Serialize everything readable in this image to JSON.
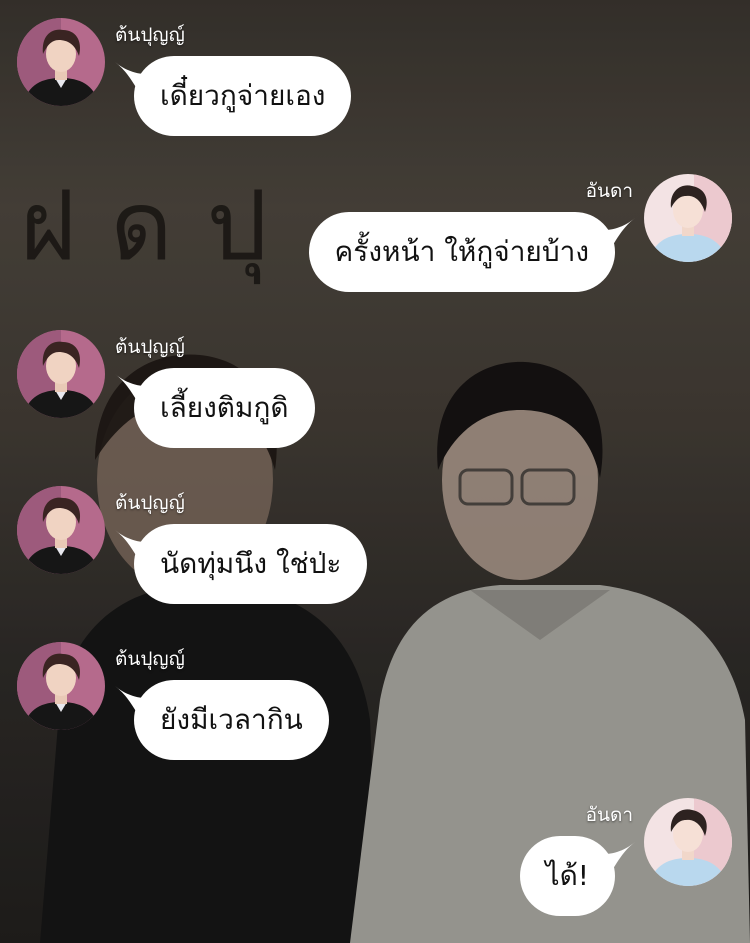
{
  "background": {
    "scrawl_text": "ฝดปุ"
  },
  "messages": [
    {
      "side": "left",
      "sender": "ต้นปุญญ์",
      "text": "เดี๋ยวกูจ่ายเอง",
      "avatar": "boy-dark-avatar"
    },
    {
      "side": "right",
      "sender": "อันดา",
      "text": "ครั้งหน้า ให้กูจ่ายบ้าง",
      "avatar": "boy-light-avatar"
    },
    {
      "side": "left",
      "sender": "ต้นปุญญ์",
      "text": "เลี้ยงติมกูดิ",
      "avatar": "boy-dark-avatar"
    },
    {
      "side": "left",
      "sender": "ต้นปุญญ์",
      "text": "นัดทุ่มนึง ใช่ป่ะ",
      "avatar": "boy-dark-avatar"
    },
    {
      "side": "left",
      "sender": "ต้นปุญญ์",
      "text": "ยังมีเวลากิน",
      "avatar": "boy-dark-avatar"
    },
    {
      "side": "right",
      "sender": "อันดา",
      "text": "ได้!",
      "avatar": "boy-light-avatar"
    }
  ],
  "colors": {
    "bubble": "#ffffff",
    "text": "#111111",
    "sender": "#ffffff"
  }
}
